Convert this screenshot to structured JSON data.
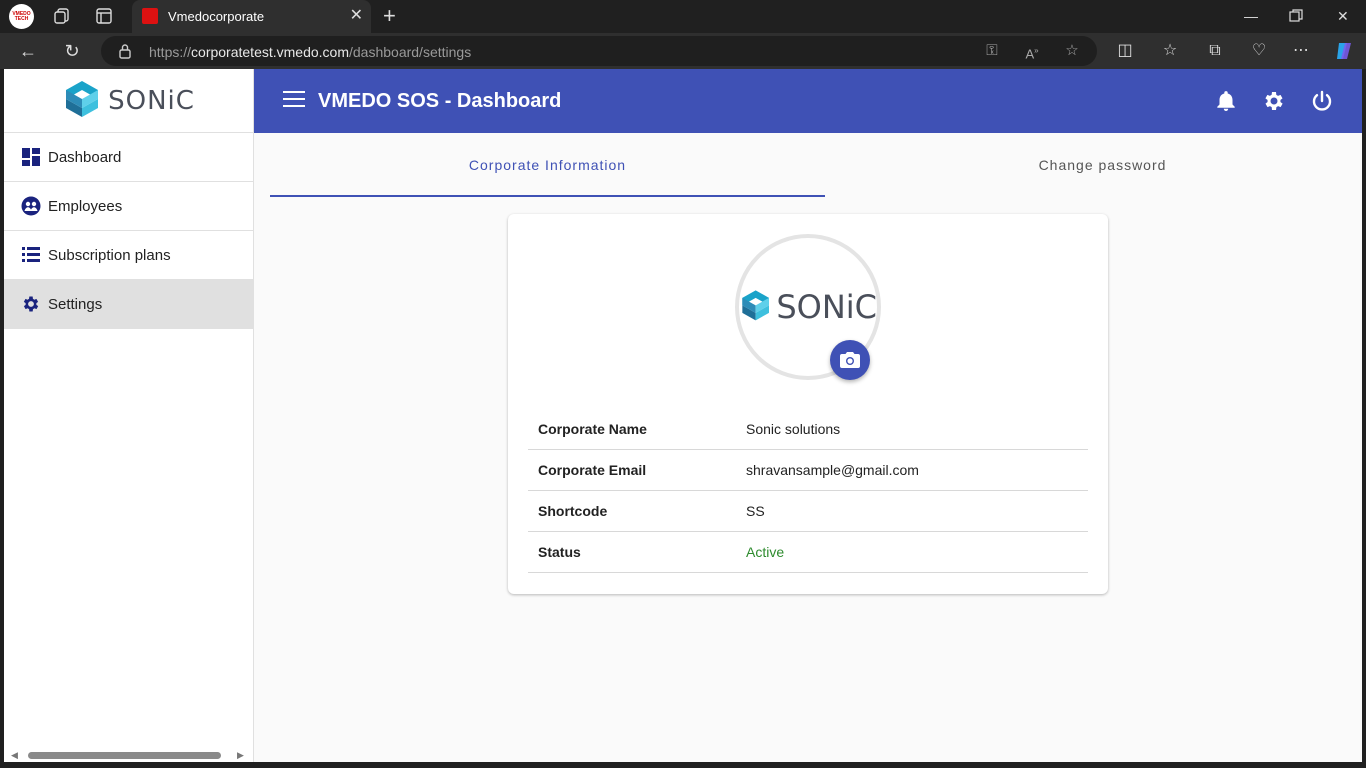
{
  "browser": {
    "profile_label": "VMEDO TECH",
    "tab_title": "Vmedocorporate",
    "url_prefix": "https://",
    "url_host": "corporatetest.vmedo.com",
    "url_path": "/dashboard/settings"
  },
  "sidebar": {
    "brand": "SONiC",
    "items": [
      {
        "label": "Dashboard",
        "icon": "dashboard-icon"
      },
      {
        "label": "Employees",
        "icon": "employees-icon"
      },
      {
        "label": "Subscription plans",
        "icon": "list-icon"
      },
      {
        "label": "Settings",
        "icon": "gear-icon"
      }
    ]
  },
  "header": {
    "title": "VMEDO SOS - Dashboard"
  },
  "tabs": [
    {
      "label": "Corporate Information",
      "active": true
    },
    {
      "label": "Change password",
      "active": false
    }
  ],
  "card": {
    "logo_text": "SONiC",
    "rows": [
      {
        "key": "Corporate Name",
        "value": "Sonic solutions"
      },
      {
        "key": "Corporate Email",
        "value": "shravansample@gmail.com"
      },
      {
        "key": "Shortcode",
        "value": "SS"
      },
      {
        "key": "Status",
        "value": "Active"
      }
    ]
  },
  "colors": {
    "primary": "#3f51b5",
    "status_active": "#2e8b2e",
    "sidebar_active": "#e0e0e0"
  }
}
